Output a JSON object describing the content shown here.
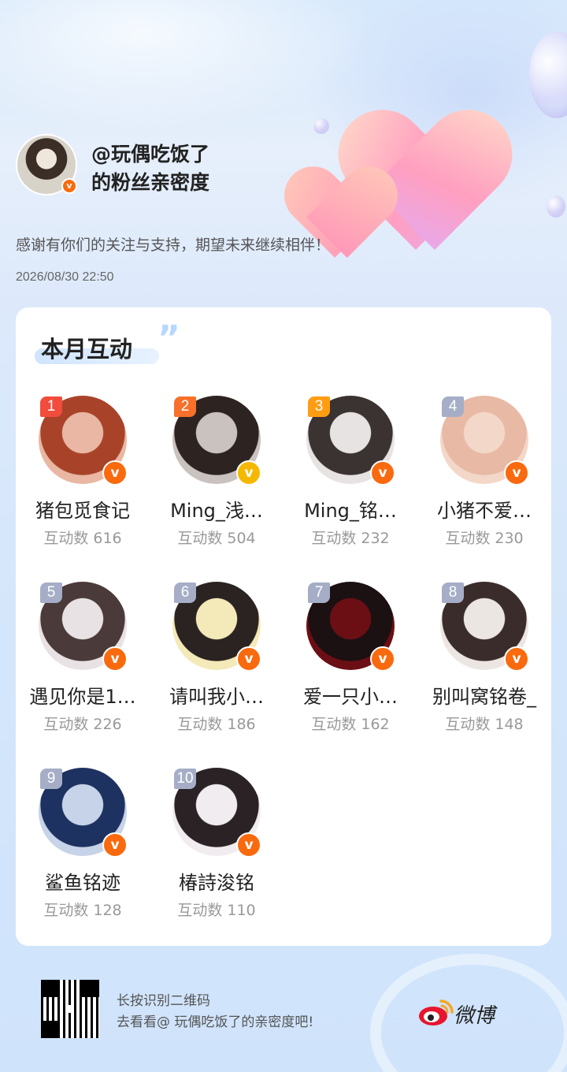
{
  "header": {
    "title_line1": "@玩偶吃饭了",
    "title_line2": "的粉丝亲密度",
    "thanks": "感谢有你们的关注与支持，期望未来继续相伴！",
    "timestamp": "2026/08/30 22:50",
    "verified_icon": "v-badge-icon"
  },
  "card": {
    "section_title": "本月互动",
    "fans": [
      {
        "rank": "1",
        "name": "猪包觅食记",
        "count": "互动数 616",
        "badge": "orange"
      },
      {
        "rank": "2",
        "name": "Ming_浅…",
        "count": "互动数 504",
        "badge": "gold"
      },
      {
        "rank": "3",
        "name": "Ming_铭…",
        "count": "互动数 232",
        "badge": "orange"
      },
      {
        "rank": "4",
        "name": "小猪不爱…",
        "count": "互动数 230",
        "badge": "orange"
      },
      {
        "rank": "5",
        "name": "遇见你是1…",
        "count": "互动数 226",
        "badge": "orange"
      },
      {
        "rank": "6",
        "name": "请叫我小…",
        "count": "互动数 186",
        "badge": "orange"
      },
      {
        "rank": "7",
        "name": "爱一只小…",
        "count": "互动数 162",
        "badge": "orange"
      },
      {
        "rank": "8",
        "name": "别叫窝铭卷_",
        "count": "互动数 148",
        "badge": "orange"
      },
      {
        "rank": "9",
        "name": "鲨鱼铭迹",
        "count": "互动数 128",
        "badge": "orange"
      },
      {
        "rank": "10",
        "name": "椿詩浚铭",
        "count": "互动数 110",
        "badge": "orange"
      }
    ]
  },
  "footer": {
    "line1": "长按识别二维码",
    "line2": "去看看@ 玩偶吃饭了的亲密度吧!",
    "brand": "微博"
  },
  "colors": {
    "badge_orange": "#f96a0e",
    "badge_gold": "#f5b800",
    "rank1": "#f24c3d",
    "rank2": "#f8702a",
    "rank3": "#ff9d12",
    "rank_other": "#a5aec6"
  }
}
